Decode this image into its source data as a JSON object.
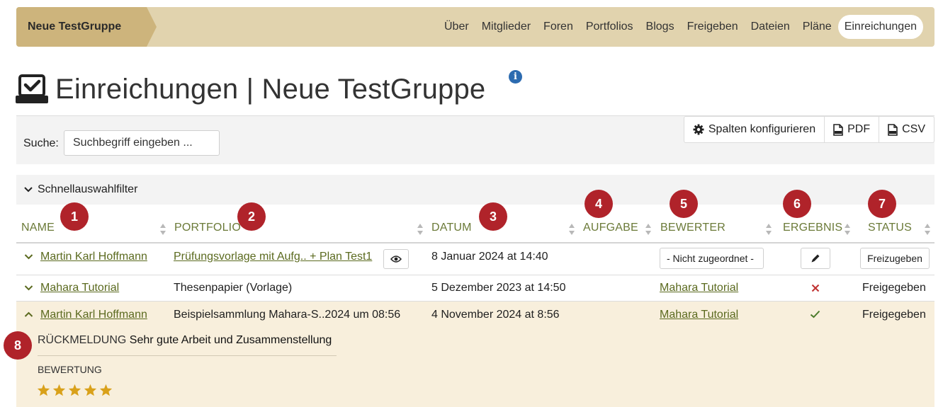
{
  "nav": {
    "group": "Neue TestGruppe",
    "items": [
      "Über",
      "Mitglieder",
      "Foren",
      "Portfolios",
      "Blogs",
      "Freigeben",
      "Dateien",
      "Pläne",
      "Einreichungen"
    ],
    "active": "Einreichungen"
  },
  "page": {
    "title": "Einreichungen | Neue TestGruppe",
    "info": "i"
  },
  "search": {
    "label": "Suche:",
    "placeholder": "Suchbegriff eingeben ..."
  },
  "toolbar": {
    "configure": "Spalten konfigurieren",
    "pdf": "PDF",
    "csv": "CSV"
  },
  "quick_filter": "Schnellauswahlfilter",
  "columns": {
    "name": "NAME",
    "portfolio": "PORTFOLIO",
    "datum": "DATUM",
    "aufgabe": "AUFGABE",
    "bewerter": "BEWERTER",
    "ergebnis": "ERGEBNIS",
    "status": "STATUS"
  },
  "badges": [
    "1",
    "2",
    "3",
    "4",
    "5",
    "6",
    "7",
    "8"
  ],
  "rows": [
    {
      "name": "Martin Karl Hoffmann",
      "portfolio": "Prüfungsvorlage mit Aufg.. + Plan Test1",
      "datum": "8 Januar 2024 at 14:40",
      "bewerter": "- Nicht zugeordnet -",
      "status": "Freizugeben"
    },
    {
      "name": "Mahara Tutorial",
      "portfolio": "Thesenpapier (Vorlage)",
      "datum": "5 Dezember 2023 at 14:50",
      "bewerter": "Mahara Tutorial",
      "status": "Freigegeben"
    },
    {
      "name": "Martin Karl Hoffmann",
      "portfolio": "Beispielsammlung Mahara-S..2024 um 08:56",
      "datum": "4 November 2024 at 8:56",
      "bewerter": "Mahara Tutorial",
      "status": "Freigegeben",
      "feedback_label": "RÜCKMELDUNG",
      "feedback": "Sehr gute Arbeit und Zusammenstellung",
      "rating_label": "BEWERTUNG",
      "rating": 5
    }
  ],
  "colors": {
    "nav_bg": "#e1d3ae",
    "nav_group_bg": "#cdb47c",
    "link": "#5b6a1f",
    "badge": "#b0232a",
    "star": "#d9a11a",
    "expanded_row_bg": "#f8efdc"
  },
  "icons": [
    "submissions-icon",
    "info-icon",
    "gear-icon",
    "pdf-file-icon",
    "csv-file-icon",
    "chevron-down-icon",
    "chevron-up-icon",
    "sort-icon",
    "eye-icon",
    "pencil-icon",
    "cross-icon",
    "check-icon",
    "star-icon"
  ]
}
